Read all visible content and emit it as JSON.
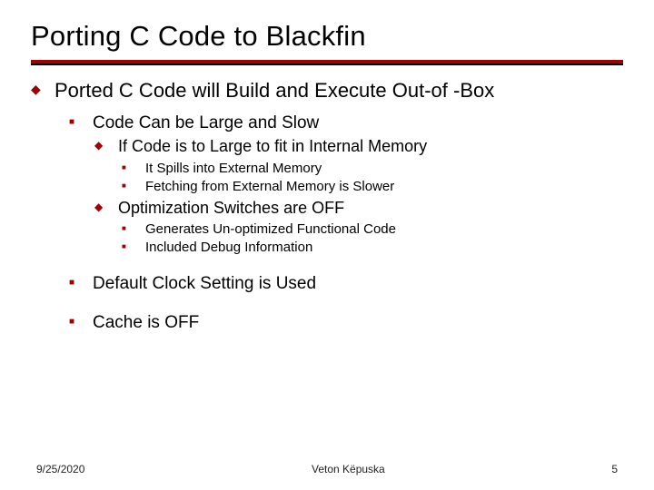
{
  "title": "Porting C Code to Blackfin",
  "main": {
    "text": "Ported C Code will Build and Execute Out-of -Box",
    "subs": [
      {
        "text": "Code Can be Large and Slow",
        "subs": [
          {
            "text": "If Code is to Large to fit in Internal Memory",
            "subs": [
              {
                "text": "It Spills into External Memory"
              },
              {
                "text": "Fetching from External Memory is Slower"
              }
            ]
          },
          {
            "text": "Optimization Switches are OFF",
            "subs": [
              {
                "text": "Generates Un-optimized Functional Code"
              },
              {
                "text": "Included Debug Information"
              }
            ]
          }
        ]
      },
      {
        "text": "Default Clock Setting is Used"
      },
      {
        "text": "Cache is OFF"
      }
    ]
  },
  "footer": {
    "date": "9/25/2020",
    "author": "Veton Këpuska",
    "page": "5"
  }
}
